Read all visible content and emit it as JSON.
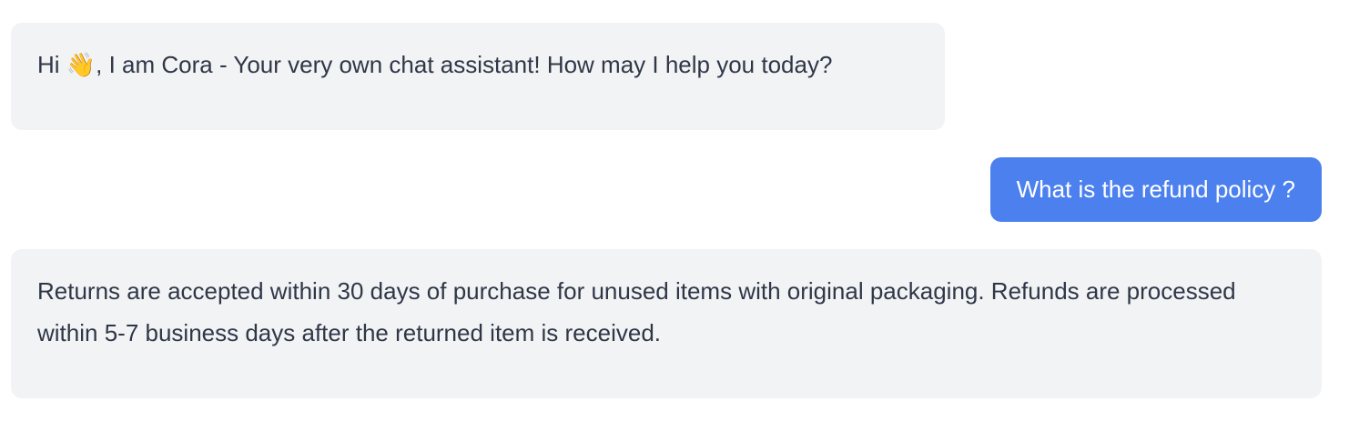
{
  "messages": [
    {
      "role": "assistant",
      "text": "Hi 👋, I am Cora - Your very own chat assistant! How may I help you today?"
    },
    {
      "role": "user",
      "text": "What is the refund policy ?"
    },
    {
      "role": "assistant",
      "text": "Returns are accepted within 30 days of purchase for unused items with original packaging. Refunds are processed within 5-7 business days after the returned item is received."
    }
  ],
  "colors": {
    "assistant_bubble": "#f2f3f5",
    "user_bubble": "#4b80ee",
    "assistant_text": "#2f3747",
    "user_text": "#ffffff"
  }
}
